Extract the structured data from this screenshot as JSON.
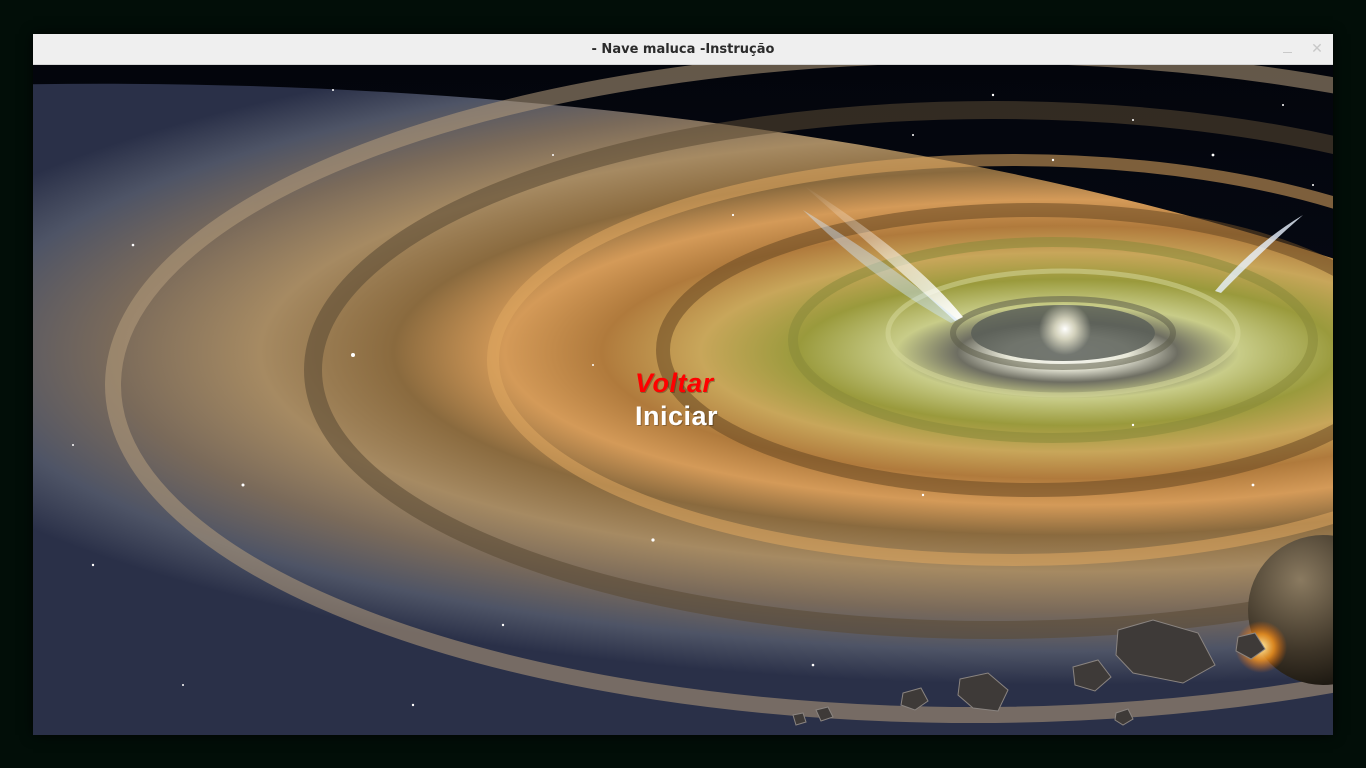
{
  "window": {
    "title": "- Nave maluca -Instrução",
    "minimize_symbol": "_",
    "close_symbol": "✕"
  },
  "menu": {
    "items": [
      {
        "label": "Voltar",
        "color": "#ff0000",
        "selected": true
      },
      {
        "label": "Iniciar",
        "color": "#ffffff",
        "selected": false
      }
    ]
  },
  "background": {
    "description_icon": "protoplanetary-disk-background"
  },
  "colors": {
    "desktop": "#020e08",
    "titlebar": "#efefef",
    "title_text": "#2b2b2b"
  }
}
